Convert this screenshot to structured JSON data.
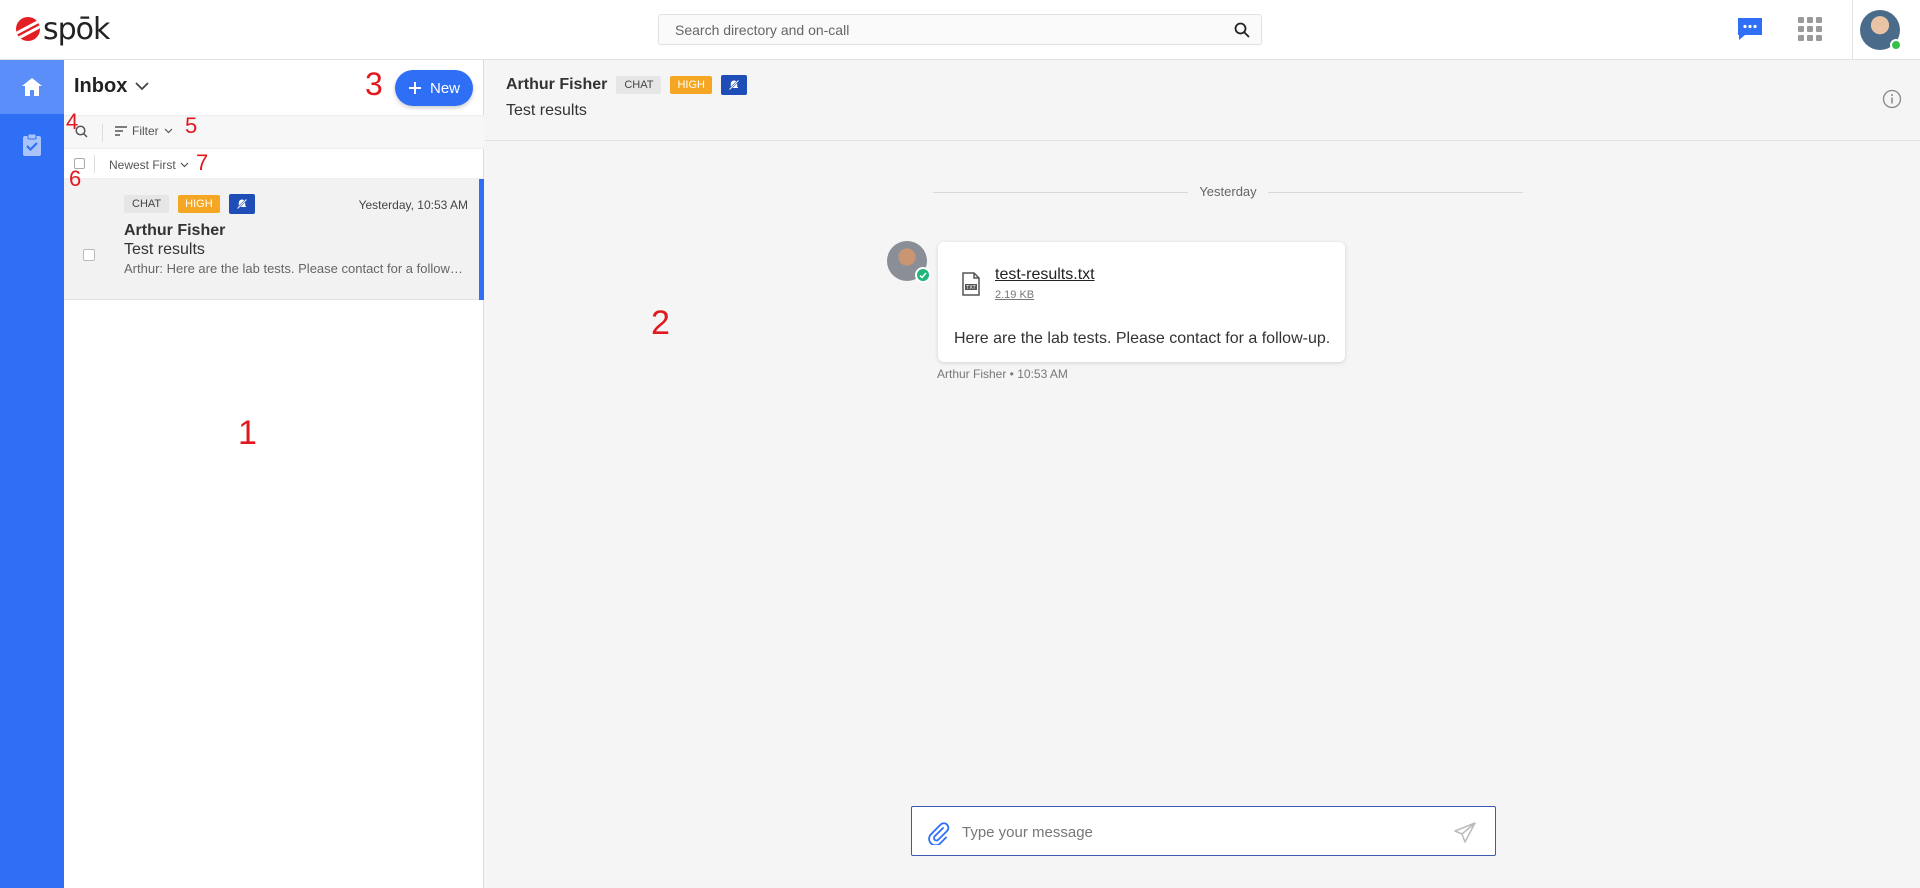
{
  "app": {
    "logo_text": "spōk"
  },
  "search": {
    "placeholder": "Search directory and on-call"
  },
  "icons": {
    "search": "search-icon",
    "chat": "chat-bubble-icon",
    "apps": "grid-apps-icon",
    "home": "home-icon",
    "tasks": "clipboard-check-icon",
    "mute": "bell-off-icon",
    "file": "txt-file-icon",
    "attach": "paperclip-icon",
    "send": "paper-plane-icon",
    "info": "info-icon"
  },
  "colors": {
    "accent": "#2e6ff5",
    "high": "#f5a623",
    "mute_tag": "#1f4db8",
    "annotation": "#e0191e"
  },
  "inbox": {
    "title": "Inbox",
    "new_label": "New",
    "filter_label": "Filter",
    "sort_label": "Newest First",
    "conversations": [
      {
        "tag_type": "CHAT",
        "tag_priority": "HIGH",
        "time": "Yesterday, 10:53 AM",
        "name": "Arthur Fisher",
        "subject": "Test results",
        "preview": "Arthur: Here are the lab tests. Please contact for a follow-up."
      }
    ]
  },
  "chat": {
    "name": "Arthur Fisher",
    "tag_type": "CHAT",
    "tag_priority": "HIGH",
    "subject": "Test results",
    "day_separator": "Yesterday",
    "message": {
      "file_name": "test-results.txt",
      "file_size": "2.19 KB",
      "text": "Here are the lab tests. Please contact for a follow-up.",
      "sender": "Arthur Fisher",
      "time": "10:53 AM",
      "meta": "Arthur Fisher • 10:53 AM"
    },
    "composer_placeholder": "Type your message"
  },
  "annotations": [
    "1",
    "2",
    "3",
    "4",
    "5",
    "6",
    "7"
  ]
}
